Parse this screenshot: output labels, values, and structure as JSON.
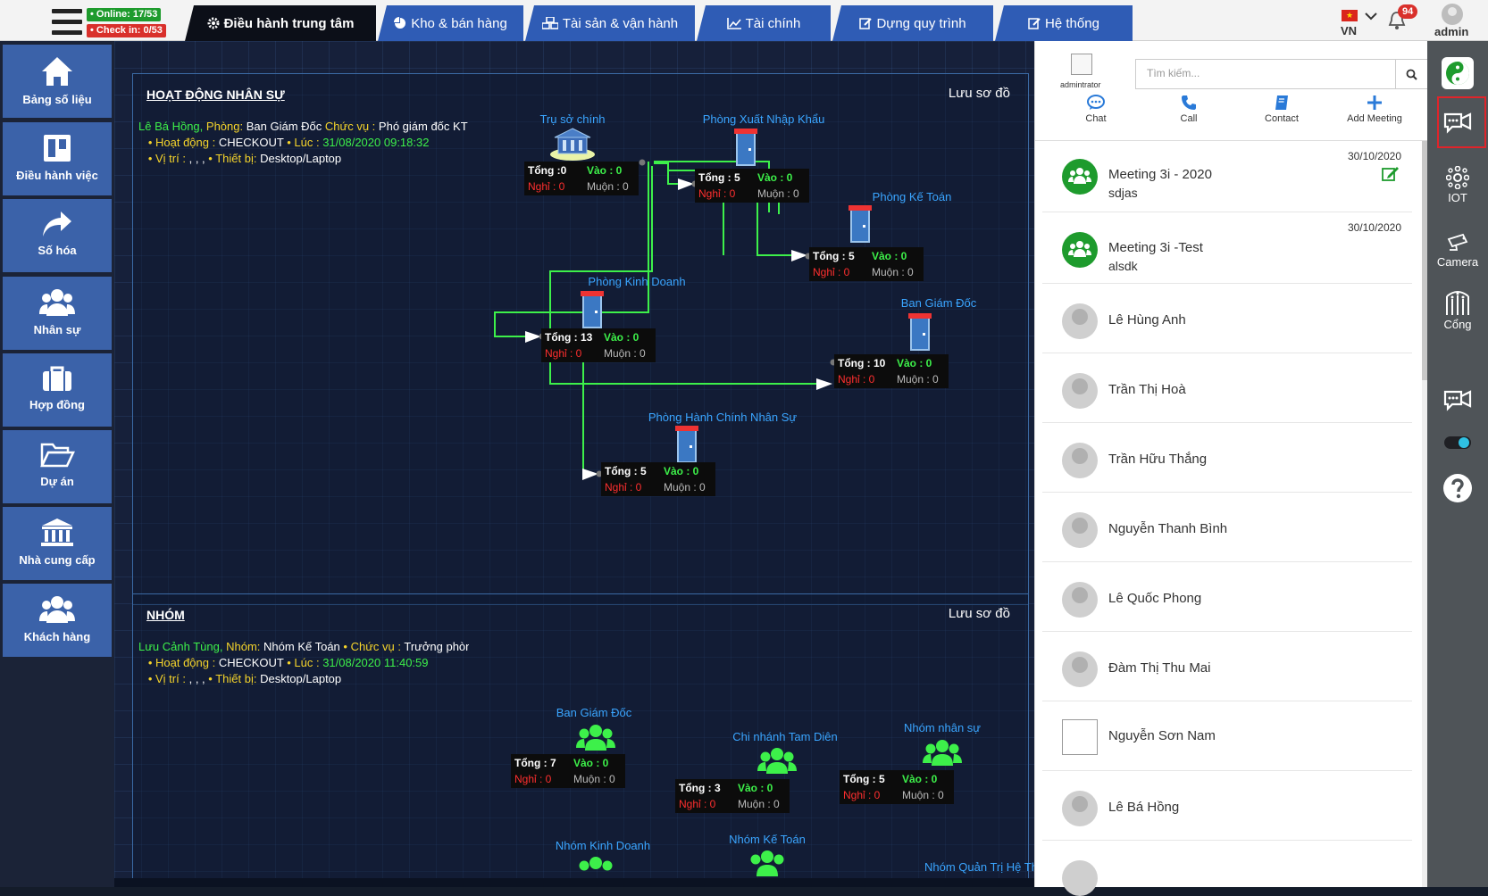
{
  "topbar": {
    "online_badge": "• Online: 17/53",
    "checkin_badge": "• Check in: 0/53",
    "tabs": [
      {
        "label": "Điều hành trung tâm",
        "icon": "gear-icon",
        "active": true
      },
      {
        "label": "Kho & bán hàng",
        "icon": "pie-chart-icon"
      },
      {
        "label": "Tài sản & vận hành",
        "icon": "cubes-icon"
      },
      {
        "label": "Tài chính",
        "icon": "line-chart-icon"
      },
      {
        "label": "Dựng quy trình",
        "icon": "edit-icon"
      },
      {
        "label": "Hệ thống",
        "icon": "edit-icon"
      }
    ],
    "lang": "VN",
    "notification_count": "94",
    "user": "admin"
  },
  "sidebar": {
    "items": [
      {
        "label": "Bảng số liệu",
        "icon": "home-icon"
      },
      {
        "label": "Điều hành việc",
        "icon": "board-icon"
      },
      {
        "label": "Số hóa",
        "icon": "share-arrow-icon"
      },
      {
        "label": "Nhân sự",
        "icon": "users-icon"
      },
      {
        "label": "Hợp đồng",
        "icon": "briefcase-icon"
      },
      {
        "label": "Dự án",
        "icon": "folder-open-icon"
      },
      {
        "label": "Nhà cung cấp",
        "icon": "bank-icon"
      },
      {
        "label": "Khách hàng",
        "icon": "users-icon"
      }
    ]
  },
  "panel1": {
    "title": "HOẠT ĐỘNG NHÂN SỰ",
    "save": "Lưu sơ đồ",
    "info": {
      "name": "Lê Bá Hồng,",
      "room_label": "Phòng:",
      "room": "Ban Giám Đốc",
      "role_label": "Chức vụ :",
      "role": "Phó giám đốc KT",
      "activity_label": "• Hoạt động :",
      "activity": "CHECKOUT",
      "time_label": "• Lúc :",
      "time": "31/08/2020 09:18:32",
      "location_label": "• Vị trí :",
      "location": ", , ,",
      "device_label": "• Thiết bị:",
      "device": "Desktop/Laptop"
    },
    "nodes": [
      {
        "name": "Trụ sở chính",
        "tong": "Tổng :0",
        "vao": "Vào : 0",
        "nghi": "Nghỉ : 0",
        "muon": "Muộn : 0"
      },
      {
        "name": "Phòng Xuất Nhập Khẩu",
        "tong": "Tổng : 5",
        "vao": "Vào : 0",
        "nghi": "Nghỉ : 0",
        "muon": "Muộn : 0"
      },
      {
        "name": "Phòng Kế Toán",
        "tong": "Tổng : 5",
        "vao": "Vào : 0",
        "nghi": "Nghỉ : 0",
        "muon": "Muộn : 0"
      },
      {
        "name": "Phòng Kinh Doanh",
        "tong": "Tổng : 13",
        "vao": "Vào : 0",
        "nghi": "Nghỉ : 0",
        "muon": "Muộn : 0"
      },
      {
        "name": "Ban Giám Đốc",
        "tong": "Tổng : 10",
        "vao": "Vào : 0",
        "nghi": "Nghỉ : 0",
        "muon": "Muộn : 0"
      },
      {
        "name": "Phòng Hành Chính Nhân Sự",
        "tong": "Tổng : 5",
        "vao": "Vào : 0",
        "nghi": "Nghỉ : 0",
        "muon": "Muộn : 0"
      }
    ]
  },
  "panel2": {
    "title": "NHÓM",
    "save": "Lưu sơ đồ",
    "info": {
      "name": "Lưu Cảnh Tùng,",
      "group_label": "Nhóm:",
      "group": "Nhóm Kế Toán",
      "role_label": "• Chức vụ :",
      "role": "Trưởng phòng",
      "activity_label": "• Hoạt động :",
      "activity": "CHECKOUT",
      "time_label": "• Lúc :",
      "time": "31/08/2020 11:40:59",
      "location_label": "• Vị trí :",
      "location": ", , ,",
      "device_label": "• Thiết bị:",
      "device": "Desktop/Laptop"
    },
    "nodes": [
      {
        "name": "Ban Giám Đốc",
        "tong": "Tổng : 7",
        "vao": "Vào : 0",
        "nghi": "Nghỉ : 0",
        "muon": "Muộn : 0"
      },
      {
        "name": "Chi nhánh Tam Diên",
        "tong": "Tổng : 3",
        "vao": "Vào : 0",
        "nghi": "Nghỉ : 0",
        "muon": "Muộn : 0"
      },
      {
        "name": "Nhóm nhân sự",
        "tong": "Tổng : 5",
        "vao": "Vào : 0",
        "nghi": "Nghỉ : 0",
        "muon": "Muộn : 0"
      }
    ],
    "partial_nodes": [
      "Nhóm Kinh Doanh",
      "Nhóm Kế Toán",
      "Nhóm Quản Trị Hệ Thố"
    ]
  },
  "chat": {
    "user_label": "admintrator",
    "search_placeholder": "Tìm kiếm...",
    "actions": [
      "Chat",
      "Call",
      "Contact",
      "Add Meeting"
    ],
    "meetings": [
      {
        "title": "Meeting 3i - 2020",
        "sub": "sdjas",
        "date": "30/10/2020"
      },
      {
        "title": "Meeting 3i -Test",
        "sub": "alsdk",
        "date": "30/10/2020"
      }
    ],
    "contacts": [
      "Lê Hùng Anh",
      "Trần Thị Hoà",
      "Trần Hữu Thắng",
      "Nguyễn Thanh Bình",
      "Lê Quốc Phong",
      "Đàm Thị Thu Mai",
      "Nguyễn Sơn Nam",
      "Lê Bá Hồng"
    ]
  },
  "iconbar": {
    "items": [
      {
        "label": "",
        "icon": "yin-yang-icon"
      },
      {
        "label": "",
        "icon": "video-chat-icon"
      },
      {
        "label": "IOT",
        "icon": "iot-icon"
      },
      {
        "label": "Camera",
        "icon": "camera-icon"
      },
      {
        "label": "Cổng",
        "icon": "gate-icon"
      },
      {
        "label": "",
        "icon": "video-chat-icon"
      },
      {
        "label": "",
        "icon": "toggle-icon"
      },
      {
        "label": "",
        "icon": "help-icon"
      }
    ]
  },
  "colors": {
    "tab_blue": "#2f5cb5",
    "sidebar_blue": "#3b62a9",
    "connector_green": "#3df04a",
    "online_green": "#1e9b2d",
    "checkin_red": "#d9302b"
  }
}
